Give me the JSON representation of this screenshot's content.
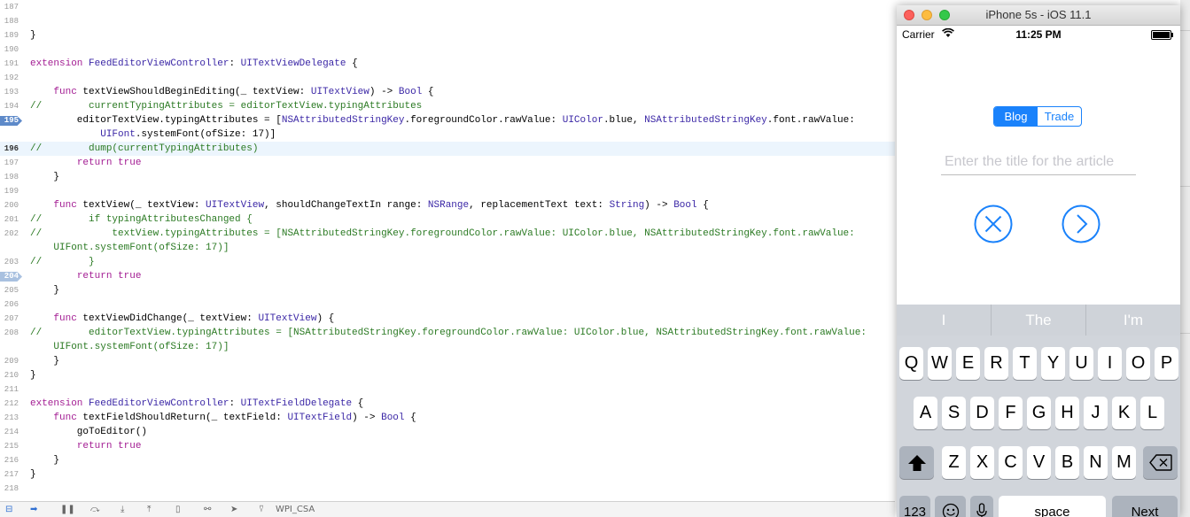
{
  "editor": {
    "lines": [
      {
        "num": "187",
        "parts": []
      },
      {
        "num": "188",
        "parts": []
      },
      {
        "num": "189",
        "parts": [
          {
            "t": "}",
            "c": ""
          }
        ]
      },
      {
        "num": "190",
        "parts": []
      },
      {
        "num": "191",
        "parts": [
          {
            "t": "extension ",
            "c": "kw"
          },
          {
            "t": "FeedEditorViewController",
            "c": "ty"
          },
          {
            "t": ": ",
            "c": ""
          },
          {
            "t": "UITextViewDelegate",
            "c": "ty"
          },
          {
            "t": " {",
            "c": ""
          }
        ]
      },
      {
        "num": "192",
        "parts": []
      },
      {
        "num": "193",
        "parts": [
          {
            "t": "    ",
            "c": ""
          },
          {
            "t": "func",
            "c": "kw"
          },
          {
            "t": " textViewShouldBeginEditing(_ textView: ",
            "c": ""
          },
          {
            "t": "UITextView",
            "c": "ty"
          },
          {
            "t": ") -> ",
            "c": ""
          },
          {
            "t": "Bool",
            "c": "ty"
          },
          {
            "t": " {",
            "c": ""
          }
        ]
      },
      {
        "num": "194",
        "parts": [
          {
            "t": "//        currentTypingAttributes = editorTextView.typingAttributes",
            "c": "cm"
          }
        ]
      },
      {
        "num": "195",
        "marker": "bp",
        "parts": [
          {
            "t": "        editorTextView.typingAttributes = [",
            "c": ""
          },
          {
            "t": "NSAttributedStringKey",
            "c": "ty"
          },
          {
            "t": ".foregroundColor.rawValue: ",
            "c": ""
          },
          {
            "t": "UIColor",
            "c": "ty"
          },
          {
            "t": ".blue, ",
            "c": ""
          },
          {
            "t": "NSAttributedStringKey",
            "c": "ty"
          },
          {
            "t": ".font.rawValue:",
            "c": ""
          }
        ]
      },
      {
        "num": "",
        "parts": [
          {
            "t": "            UIFont",
            "c": "ty"
          },
          {
            "t": ".systemFont(ofSize: 17)]",
            "c": ""
          }
        ]
      },
      {
        "num": "196",
        "current": true,
        "parts": [
          {
            "t": "//        dump(currentTypingAttributes)",
            "c": "cm"
          }
        ]
      },
      {
        "num": "197",
        "parts": [
          {
            "t": "        ",
            "c": ""
          },
          {
            "t": "return",
            "c": "kw"
          },
          {
            "t": " ",
            "c": ""
          },
          {
            "t": "true",
            "c": "kw"
          }
        ]
      },
      {
        "num": "198",
        "parts": [
          {
            "t": "    }",
            "c": ""
          }
        ]
      },
      {
        "num": "199",
        "parts": []
      },
      {
        "num": "200",
        "parts": [
          {
            "t": "    ",
            "c": ""
          },
          {
            "t": "func",
            "c": "kw"
          },
          {
            "t": " textView(_ textView: ",
            "c": ""
          },
          {
            "t": "UITextView",
            "c": "ty"
          },
          {
            "t": ", shouldChangeTextIn range: ",
            "c": ""
          },
          {
            "t": "NSRange",
            "c": "ty"
          },
          {
            "t": ", replacementText text: ",
            "c": ""
          },
          {
            "t": "String",
            "c": "ty"
          },
          {
            "t": ") -> ",
            "c": ""
          },
          {
            "t": "Bool",
            "c": "ty"
          },
          {
            "t": " {",
            "c": ""
          }
        ]
      },
      {
        "num": "201",
        "parts": [
          {
            "t": "//        if typingAttributesChanged {",
            "c": "cm"
          }
        ]
      },
      {
        "num": "202",
        "parts": [
          {
            "t": "//            textView.typingAttributes = [NSAttributedStringKey.foregroundColor.rawValue: UIColor.blue, NSAttributedStringKey.font.rawValue:",
            "c": "cm"
          }
        ]
      },
      {
        "num": "",
        "parts": [
          {
            "t": "    UIFont.systemFont(ofSize: 17)]",
            "c": "cm"
          }
        ]
      },
      {
        "num": "203",
        "parts": [
          {
            "t": "//        }",
            "c": "cm"
          }
        ]
      },
      {
        "num": "204",
        "marker": "bp-dim",
        "parts": [
          {
            "t": "        ",
            "c": ""
          },
          {
            "t": "return",
            "c": "kw"
          },
          {
            "t": " ",
            "c": ""
          },
          {
            "t": "true",
            "c": "kw"
          }
        ]
      },
      {
        "num": "205",
        "parts": [
          {
            "t": "    }",
            "c": ""
          }
        ]
      },
      {
        "num": "206",
        "parts": []
      },
      {
        "num": "207",
        "parts": [
          {
            "t": "    ",
            "c": ""
          },
          {
            "t": "func",
            "c": "kw"
          },
          {
            "t": " textViewDidChange(_ textView: ",
            "c": ""
          },
          {
            "t": "UITextView",
            "c": "ty"
          },
          {
            "t": ") {",
            "c": ""
          }
        ]
      },
      {
        "num": "208",
        "parts": [
          {
            "t": "//        editorTextView.typingAttributes = [NSAttributedStringKey.foregroundColor.rawValue: UIColor.blue, NSAttributedStringKey.font.rawValue:",
            "c": "cm"
          }
        ]
      },
      {
        "num": "",
        "parts": [
          {
            "t": "    UIFont.systemFont(ofSize: 17)]",
            "c": "cm"
          }
        ]
      },
      {
        "num": "209",
        "parts": [
          {
            "t": "    }",
            "c": ""
          }
        ]
      },
      {
        "num": "210",
        "parts": [
          {
            "t": "}",
            "c": ""
          }
        ]
      },
      {
        "num": "211",
        "parts": []
      },
      {
        "num": "212",
        "parts": [
          {
            "t": "extension ",
            "c": "kw"
          },
          {
            "t": "FeedEditorViewController",
            "c": "ty"
          },
          {
            "t": ": ",
            "c": ""
          },
          {
            "t": "UITextFieldDelegate",
            "c": "ty"
          },
          {
            "t": " {",
            "c": ""
          }
        ]
      },
      {
        "num": "213",
        "parts": [
          {
            "t": "    ",
            "c": ""
          },
          {
            "t": "func",
            "c": "kw"
          },
          {
            "t": " textFieldShouldReturn(_ textField: ",
            "c": ""
          },
          {
            "t": "UITextField",
            "c": "ty"
          },
          {
            "t": ") -> ",
            "c": ""
          },
          {
            "t": "Bool",
            "c": "ty"
          },
          {
            "t": " {",
            "c": ""
          }
        ]
      },
      {
        "num": "214",
        "parts": [
          {
            "t": "        goToEditor()",
            "c": ""
          }
        ]
      },
      {
        "num": "215",
        "parts": [
          {
            "t": "        ",
            "c": ""
          },
          {
            "t": "return",
            "c": "kw"
          },
          {
            "t": " ",
            "c": ""
          },
          {
            "t": "true",
            "c": "kw"
          }
        ]
      },
      {
        "num": "216",
        "parts": [
          {
            "t": "    }",
            "c": ""
          }
        ]
      },
      {
        "num": "217",
        "parts": [
          {
            "t": "}",
            "c": ""
          }
        ]
      },
      {
        "num": "218",
        "parts": []
      }
    ]
  },
  "debug_bar": {
    "target": "WPI_CSA"
  },
  "simulator": {
    "window_title": "iPhone 5s - iOS 11.1",
    "status": {
      "carrier": "Carrier",
      "time": "11:25 PM"
    },
    "segments": [
      "Blog",
      "Trade"
    ],
    "title_placeholder": "Enter the title for the article",
    "suggestions": [
      "I",
      "The",
      "I'm"
    ],
    "keyboard": {
      "row1": [
        "Q",
        "W",
        "E",
        "R",
        "T",
        "Y",
        "U",
        "I",
        "O",
        "P"
      ],
      "row2": [
        "A",
        "S",
        "D",
        "F",
        "G",
        "H",
        "J",
        "K",
        "L"
      ],
      "row3": [
        "Z",
        "X",
        "C",
        "V",
        "B",
        "N",
        "M"
      ],
      "numbers_key": "123",
      "space_key": "space",
      "return_key": "Next"
    }
  },
  "colors": {
    "ios_blue": "#1a82fb",
    "keyword": "#a31d93",
    "type": "#3b27a6",
    "comment": "#2b7a23"
  }
}
